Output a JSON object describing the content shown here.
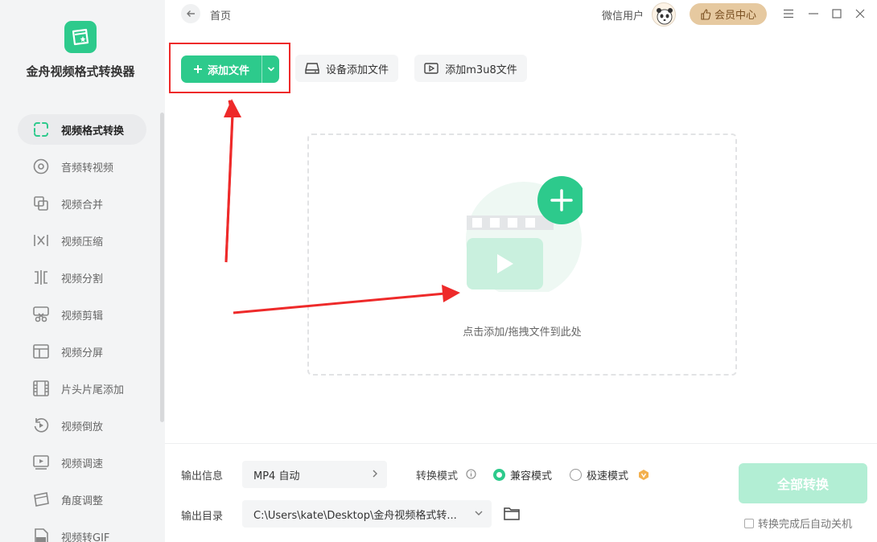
{
  "app": {
    "title": "金舟视频格式转换器"
  },
  "sidebar": {
    "items": [
      {
        "label": "视频格式转换",
        "icon": "video-convert-icon",
        "active": true
      },
      {
        "label": "音频转视频",
        "icon": "audio-disc-icon"
      },
      {
        "label": "视频合并",
        "icon": "merge-icon"
      },
      {
        "label": "视频压缩",
        "icon": "compress-icon"
      },
      {
        "label": "视频分割",
        "icon": "split-icon"
      },
      {
        "label": "视频剪辑",
        "icon": "scissors-icon"
      },
      {
        "label": "视频分屏",
        "icon": "split-screen-icon"
      },
      {
        "label": "片头片尾添加",
        "icon": "film-strip-icon"
      },
      {
        "label": "视频倒放",
        "icon": "reverse-icon"
      },
      {
        "label": "视频调速",
        "icon": "speed-icon"
      },
      {
        "label": "角度调整",
        "icon": "angle-icon"
      },
      {
        "label": "视频转GIF",
        "icon": "gif-icon"
      }
    ]
  },
  "topbar": {
    "home": "首页",
    "user": "微信用户",
    "vip": "会员中心"
  },
  "toolbar": {
    "add_file": "添加文件",
    "device_add": "设备添加文件",
    "add_m3u8": "添加m3u8文件"
  },
  "dropzone": {
    "hint": "点击添加/拖拽文件到此处"
  },
  "bottom": {
    "output_info_label": "输出信息",
    "output_format": "MP4 自动",
    "mode_label": "转换模式",
    "mode_compatible": "兼容模式",
    "mode_fast": "极速模式",
    "output_dir_label": "输出目录",
    "output_dir": "C:\\Users\\kate\\Desktop\\金舟视频格式转...",
    "convert_all": "全部转换",
    "auto_shutdown": "转换完成后自动关机"
  },
  "colors": {
    "accent": "#2dca8c",
    "highlight": "#ee2a2a",
    "vip": "#e6c9a0"
  }
}
